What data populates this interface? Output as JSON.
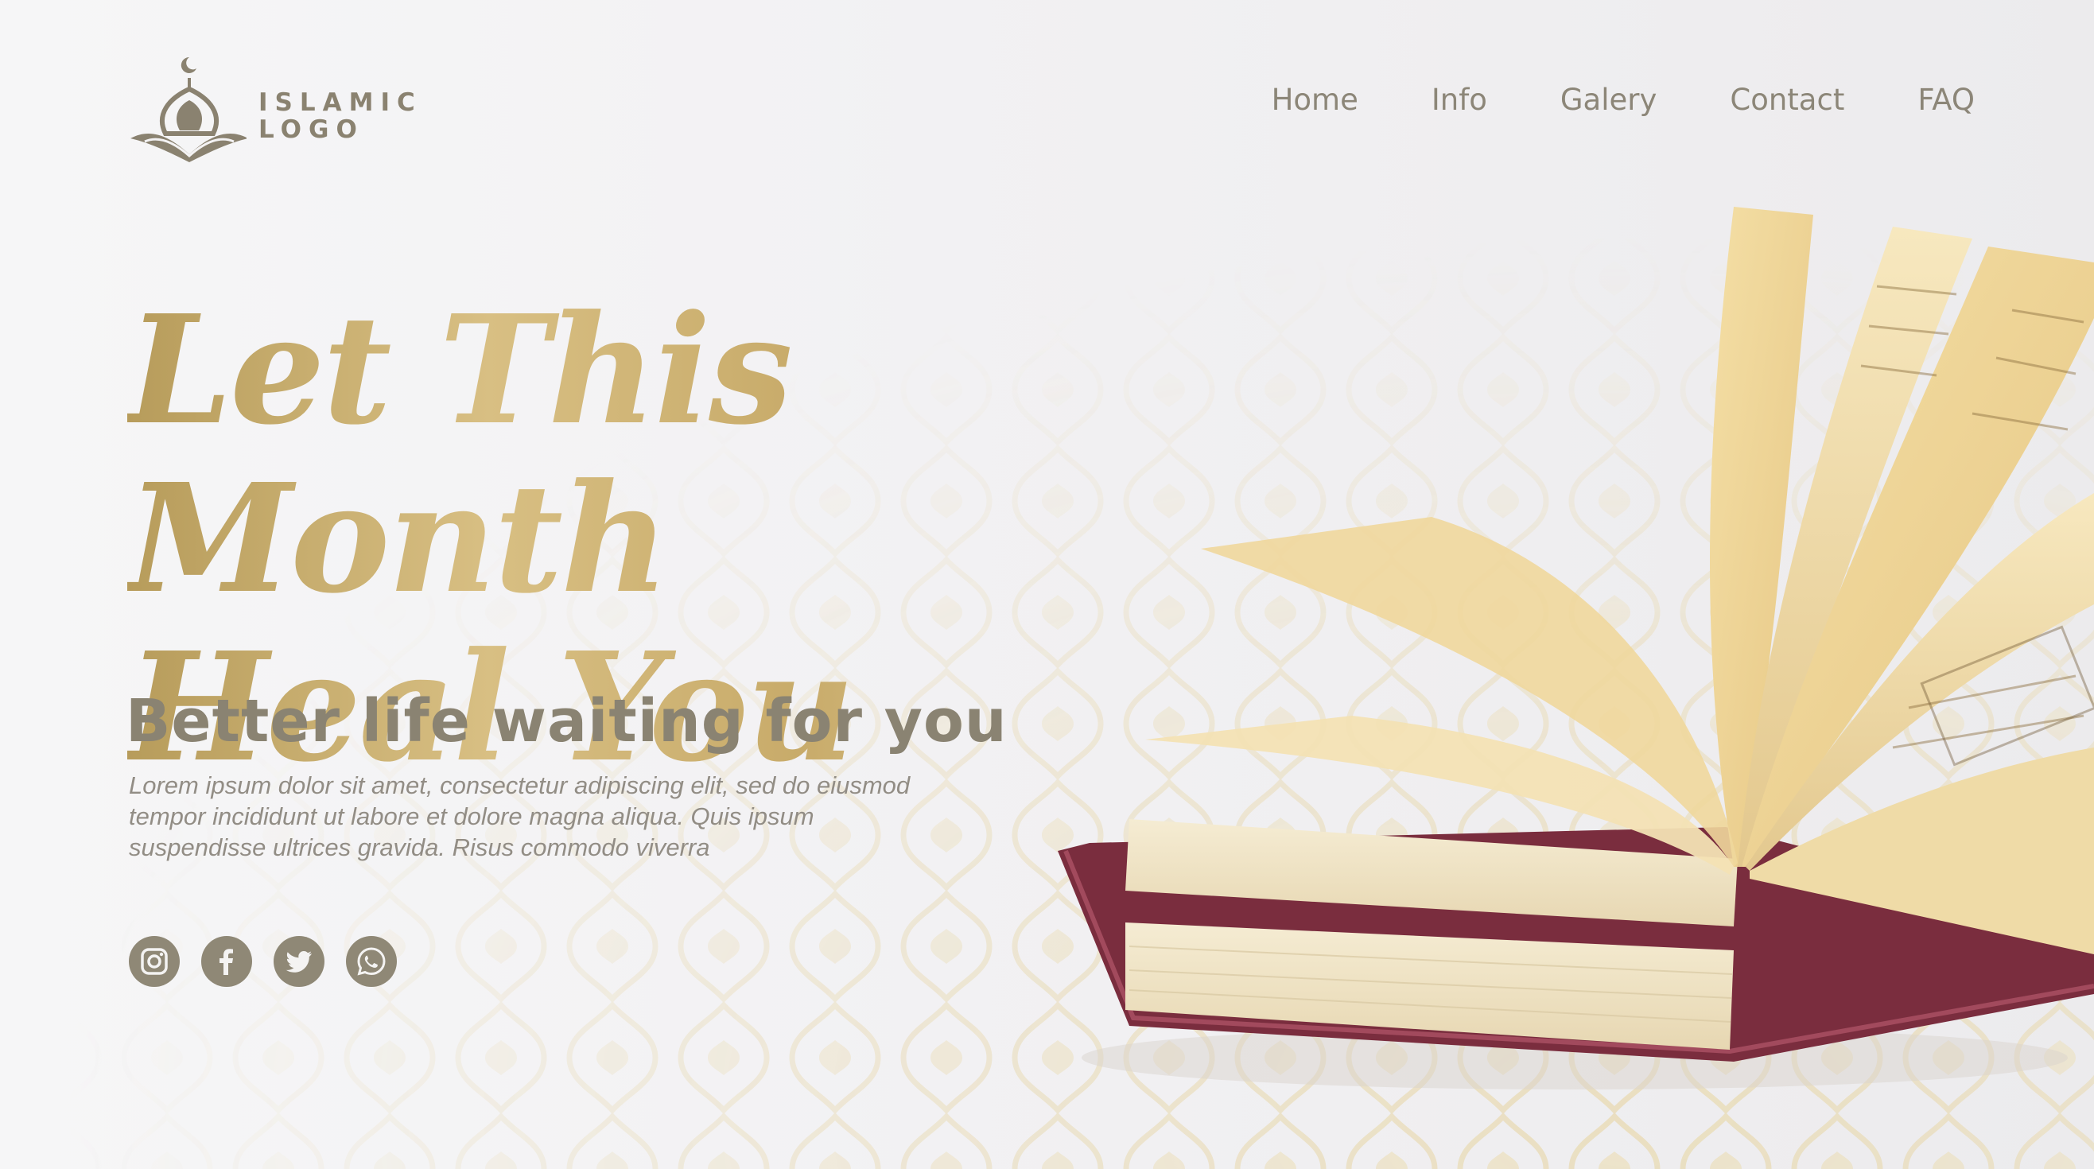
{
  "logo": {
    "line1": "ISLAMIC",
    "line2": "LOGO",
    "mark_icon": "mosque-crescent-icon"
  },
  "nav": {
    "items": [
      {
        "label": "Home"
      },
      {
        "label": "Info"
      },
      {
        "label": "Galery"
      },
      {
        "label": "Contact"
      },
      {
        "label": "FAQ"
      }
    ]
  },
  "hero": {
    "headline_line1": "Let This Month",
    "headline_line2": "Heal You",
    "subhead": "Better life waiting for you",
    "body": "Lorem ipsum dolor sit amet, consectetur adipiscing elit, sed do eiusmod tempor incididunt ut labore et dolore magna aliqua. Quis ipsum suspendisse ultrices gravida. Risus commodo viverra"
  },
  "social": [
    {
      "icon": "instagram-icon"
    },
    {
      "icon": "facebook-icon"
    },
    {
      "icon": "twitter-icon"
    },
    {
      "icon": "whatsapp-icon"
    }
  ],
  "colors": {
    "gold": "#c8ab6a",
    "taupe": "#8f8876",
    "background": "#f3f2f4",
    "book_cover": "#7a2d3e"
  }
}
